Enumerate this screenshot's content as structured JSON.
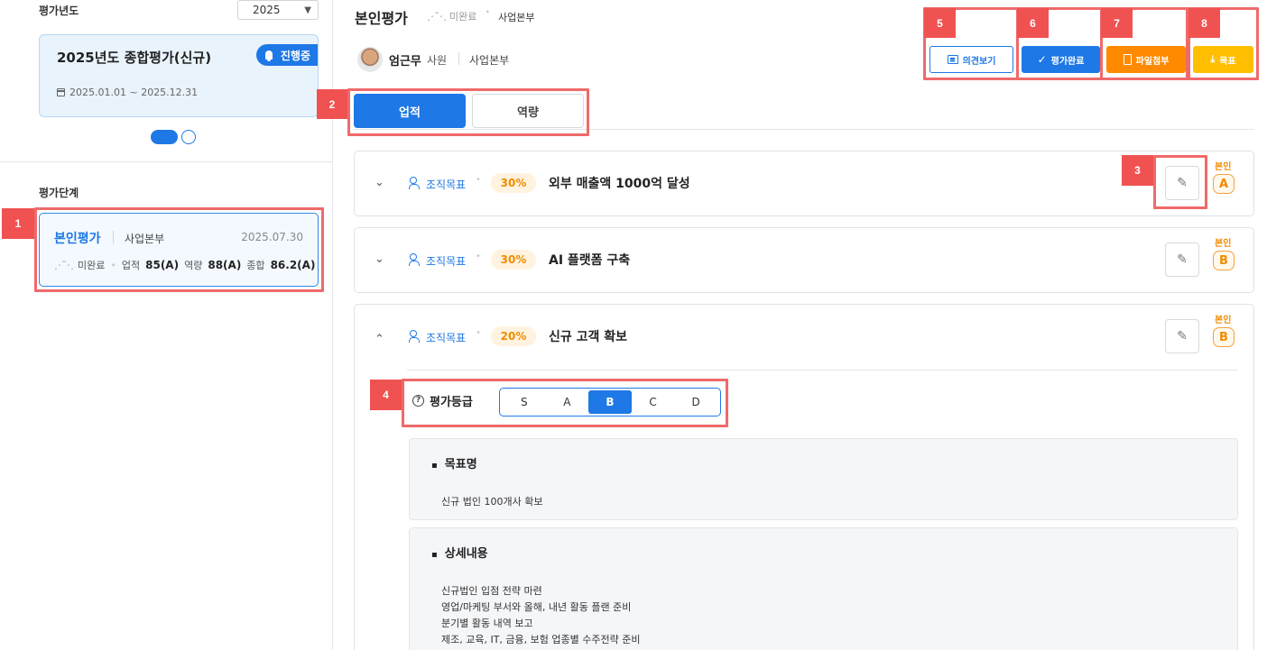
{
  "sidebar": {
    "year_title": "평가년도",
    "year_value": "2025",
    "card": {
      "title": "2025년도 종합평가(신규)",
      "status": "진행중",
      "period": "2025.01.01 ~ 2025.12.31"
    },
    "stage_title": "평가단계",
    "stage": {
      "name": "본인평가",
      "dept": "사업본부",
      "date": "2025.07.30",
      "status": "미완료",
      "perf_label": "업적",
      "perf_value": "85(A)",
      "comp_label": "역량",
      "comp_value": "88(A)",
      "total_label": "종합",
      "total_value": "86.2(A)"
    }
  },
  "header": {
    "title": "본인평가",
    "status": "미완료",
    "dept": "사업본부"
  },
  "user": {
    "name": "엄근무",
    "rank": "사원",
    "dept": "사업본부"
  },
  "actions": {
    "opinion": "의견보기",
    "complete": "평가완료",
    "file": "파일첨부",
    "goal": "목표"
  },
  "tabs": [
    "업적",
    "역량"
  ],
  "goals": [
    {
      "type": "조직목표",
      "weight": "30%",
      "name": "외부 매출액 1000억 달성",
      "self_label": "본인",
      "grade": "A",
      "expanded": false
    },
    {
      "type": "조직목표",
      "weight": "30%",
      "name": "AI 플랫폼 구축",
      "self_label": "본인",
      "grade": "B",
      "expanded": false
    },
    {
      "type": "조직목표",
      "weight": "20%",
      "name": "신규 고객 확보",
      "self_label": "본인",
      "grade": "B",
      "expanded": true
    }
  ],
  "grading": {
    "label": "평가등급",
    "options": [
      "S",
      "A",
      "B",
      "C",
      "D"
    ],
    "selected": "B"
  },
  "detail": {
    "goal_title": "목표명",
    "goal_text": "신규 법인 100개사 확보",
    "content_title": "상세내용",
    "content_lines": [
      "신규법인 입점 전략 마련",
      "영업/마케팅 부서와 올해, 내년 활동 플랜 준비",
      "분기별 활동 내역 보고",
      "제조, 교육, IT, 금융, 보험 업종별 수주전략 준비"
    ]
  },
  "annotations": [
    "1",
    "2",
    "3",
    "4",
    "5",
    "6",
    "7",
    "8"
  ],
  "colors": {
    "primary": "#1e78e6",
    "orange": "#ff8a00",
    "yellow": "#ffbf00",
    "marker": "#f05252"
  }
}
